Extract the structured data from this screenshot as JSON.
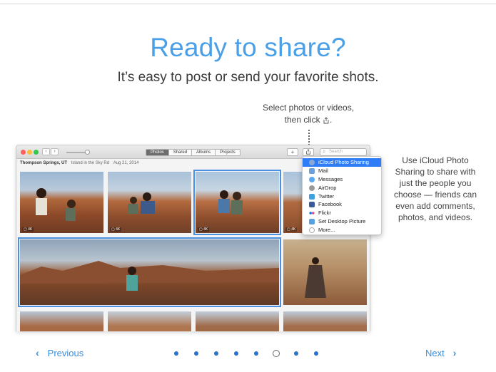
{
  "heading": {
    "title": "Ready to share?",
    "subtitle": "It’s easy to post or send your favorite shots."
  },
  "callouts": {
    "top_line1": "Select photos or videos,",
    "top_line2": "then click",
    "top_icon": "share-icon",
    "right": "Use iCloud Photo Sharing to share with just the people you choose — friends can even add comments, photos, and videos."
  },
  "window": {
    "tabs": [
      "Photos",
      "Shared",
      "Albums",
      "Projects"
    ],
    "active_tab": "Photos",
    "search_placeholder": "Search",
    "location": {
      "place": "Thompson Springs, UT",
      "detail": "Island in the Sky Rd",
      "date": "Aug 21, 2014"
    },
    "photos": [
      {
        "badge": "▢ 4K",
        "selected": false
      },
      {
        "badge": "▢ 4K",
        "selected": false
      },
      {
        "badge": "▢ 4K",
        "selected": true
      },
      {
        "badge": "▢ 4K",
        "selected": false
      },
      {
        "badge": "",
        "selected": true
      },
      {
        "badge": "",
        "selected": false
      }
    ]
  },
  "share_menu": {
    "items": [
      {
        "label": "iCloud Photo Sharing",
        "icon": "icloud-icon",
        "color": "#8aa9d6",
        "highlighted": true
      },
      {
        "label": "Mail",
        "icon": "mail-icon",
        "color": "#6fa0d8"
      },
      {
        "label": "Messages",
        "icon": "messages-icon",
        "color": "#5aa9f0"
      },
      {
        "label": "AirDrop",
        "icon": "airdrop-icon",
        "color": "#9a9a9a"
      },
      {
        "label": "Twitter",
        "icon": "twitter-icon",
        "color": "#3fa0e0"
      },
      {
        "label": "Facebook",
        "icon": "facebook-icon",
        "color": "#3b5998"
      },
      {
        "label": "Flickr",
        "icon": "flickr-icon",
        "color": "#e04a8a"
      },
      {
        "label": "Set Desktop Picture",
        "icon": "desktop-icon",
        "color": "#58a0e0"
      },
      {
        "label": "More...",
        "icon": "more-icon",
        "color": "#aaaaaa"
      }
    ]
  },
  "nav": {
    "previous": "Previous",
    "next": "Next",
    "page_count": 8,
    "current_page": 6,
    "accent": "#3b8ede"
  }
}
